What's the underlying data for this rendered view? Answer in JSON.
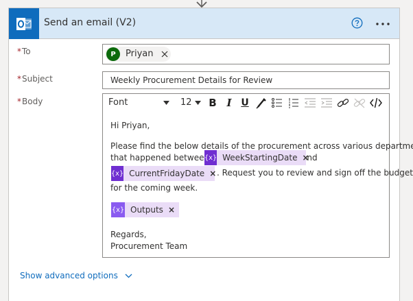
{
  "action": {
    "title": "Send an email (V2)",
    "icon": "outlook-icon",
    "help_icon": "question-circle-icon",
    "more_icon": "ellipsis-icon"
  },
  "fields": {
    "to": {
      "label": "To",
      "required_mark": "*",
      "recipient": {
        "initial": "P",
        "name": "Priyan"
      }
    },
    "subject": {
      "label": "Subject",
      "required_mark": "*",
      "value": "Weekly Procurement Details for Review"
    },
    "body": {
      "label": "Body",
      "required_mark": "*",
      "toolbar": {
        "font": "Font",
        "size": "12",
        "bold": "B",
        "italic": "I",
        "underline": "U"
      },
      "content": {
        "greeting": "Hi Priyan,",
        "para_line1": "Please find the below details of the procurement across various department",
        "para_line2_prefix": "that happened between",
        "para_and": "and",
        "para_line3_suffix": ". Request you to review and sign off the budget",
        "para_line4": "for the coming week.",
        "closing1": "Regards,",
        "closing2": "Procurement Team"
      },
      "tokens": {
        "week_start": {
          "icon_text": "{x}",
          "label": "WeekStartingDate",
          "close": "×"
        },
        "current_friday": {
          "icon_text": "{x}",
          "label": "CurrentFridayDate",
          "close": "×"
        },
        "outputs": {
          "icon_text": "{x}",
          "label": "Outputs",
          "close": "×"
        }
      }
    }
  },
  "advanced_options": "Show advanced options",
  "colors": {
    "header_bg": "#d7e8f7",
    "outlook_blue": "#0f6cbd",
    "variable_token": "#6f2ed1",
    "outputs_token": "#8a5bf0",
    "token_bg": "#eadcf7",
    "avatar_green": "#0b6a0b"
  }
}
